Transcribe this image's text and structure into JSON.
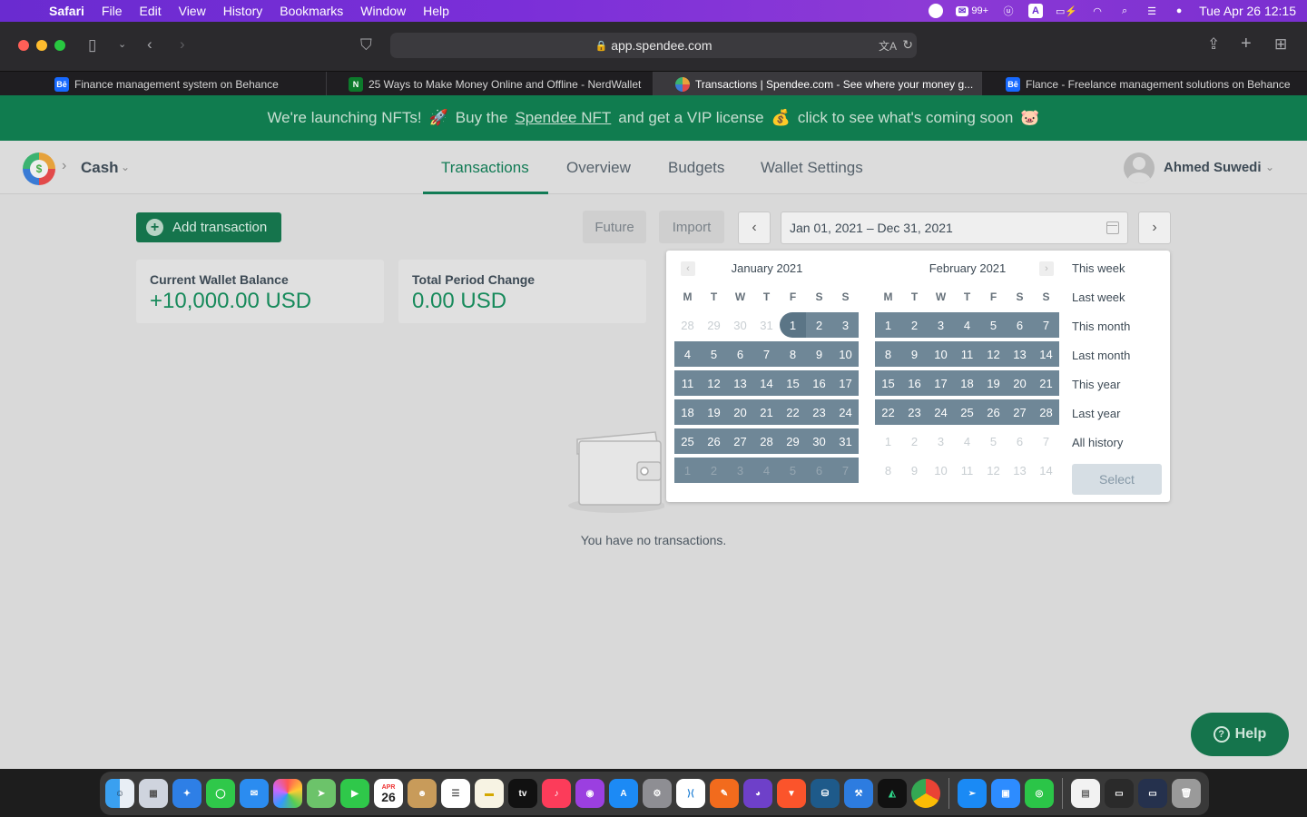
{
  "menubar": {
    "app": "Safari",
    "items": [
      "File",
      "Edit",
      "View",
      "History",
      "Bookmarks",
      "Window",
      "Help"
    ],
    "badge": "99+",
    "datetime": "Tue Apr 26  12:15"
  },
  "browser": {
    "url": "app.spendee.com",
    "tabs": [
      {
        "label": "Finance management system on Behance",
        "favicon": "Bē"
      },
      {
        "label": "25 Ways to Make Money Online and Offline - NerdWallet",
        "favicon": "N"
      },
      {
        "label": "Transactions | Spendee.com - See where your money g...",
        "favicon": ""
      },
      {
        "label": "Flance - Freelance management solutions on Behance",
        "favicon": "Bē"
      }
    ]
  },
  "banner": {
    "part1": "We're launching NFTs!",
    "emoji1": "🚀",
    "part2": "Buy the",
    "link": "Spendee NFT",
    "part3": "and get a VIP license",
    "emoji2": "💰",
    "part4": "click to see what's coming soon",
    "emoji3": "🐷"
  },
  "header": {
    "wallet": "Cash",
    "nav": [
      "Transactions",
      "Overview",
      "Budgets",
      "Wallet Settings"
    ],
    "user": "Ahmed Suwedi"
  },
  "main": {
    "add_label": "Add transaction",
    "future_label": "Future",
    "import_label": "Import",
    "date_range": "Jan 01, 2021 – Dec 31, 2021",
    "balance_label": "Current Wallet Balance",
    "balance_value": "+10,000.00 USD",
    "change_label": "Total Period Change",
    "change_value": "0.00 USD",
    "empty_text": "You have no transactions.",
    "help_label": "Help"
  },
  "picker": {
    "dow": [
      "M",
      "T",
      "W",
      "T",
      "F",
      "S",
      "S"
    ],
    "months": [
      {
        "title": "January 2021",
        "weeks": [
          [
            "28",
            "29",
            "30",
            "31",
            "1",
            "2",
            "3"
          ],
          [
            "4",
            "5",
            "6",
            "7",
            "8",
            "9",
            "10"
          ],
          [
            "11",
            "12",
            "13",
            "14",
            "15",
            "16",
            "17"
          ],
          [
            "18",
            "19",
            "20",
            "21",
            "22",
            "23",
            "24"
          ],
          [
            "25",
            "26",
            "27",
            "28",
            "29",
            "30",
            "31"
          ],
          [
            "1",
            "2",
            "3",
            "4",
            "5",
            "6",
            "7"
          ]
        ]
      },
      {
        "title": "February 2021",
        "weeks": [
          [
            "1",
            "2",
            "3",
            "4",
            "5",
            "6",
            "7"
          ],
          [
            "8",
            "9",
            "10",
            "11",
            "12",
            "13",
            "14"
          ],
          [
            "15",
            "16",
            "17",
            "18",
            "19",
            "20",
            "21"
          ],
          [
            "22",
            "23",
            "24",
            "25",
            "26",
            "27",
            "28"
          ],
          [
            "1",
            "2",
            "3",
            "4",
            "5",
            "6",
            "7"
          ],
          [
            "8",
            "9",
            "10",
            "11",
            "12",
            "13",
            "14"
          ]
        ]
      }
    ],
    "presets": [
      "This week",
      "Last week",
      "This month",
      "Last month",
      "This year",
      "Last year",
      "All history"
    ],
    "select_label": "Select"
  },
  "dock": {
    "calendar_day": "26",
    "calendar_month": "APR"
  },
  "colors": {
    "brand_green": "#15744c",
    "banner_green": "#107c4f",
    "selected_day": "#6f8797",
    "menubar_purple": "#7b2fd8"
  }
}
